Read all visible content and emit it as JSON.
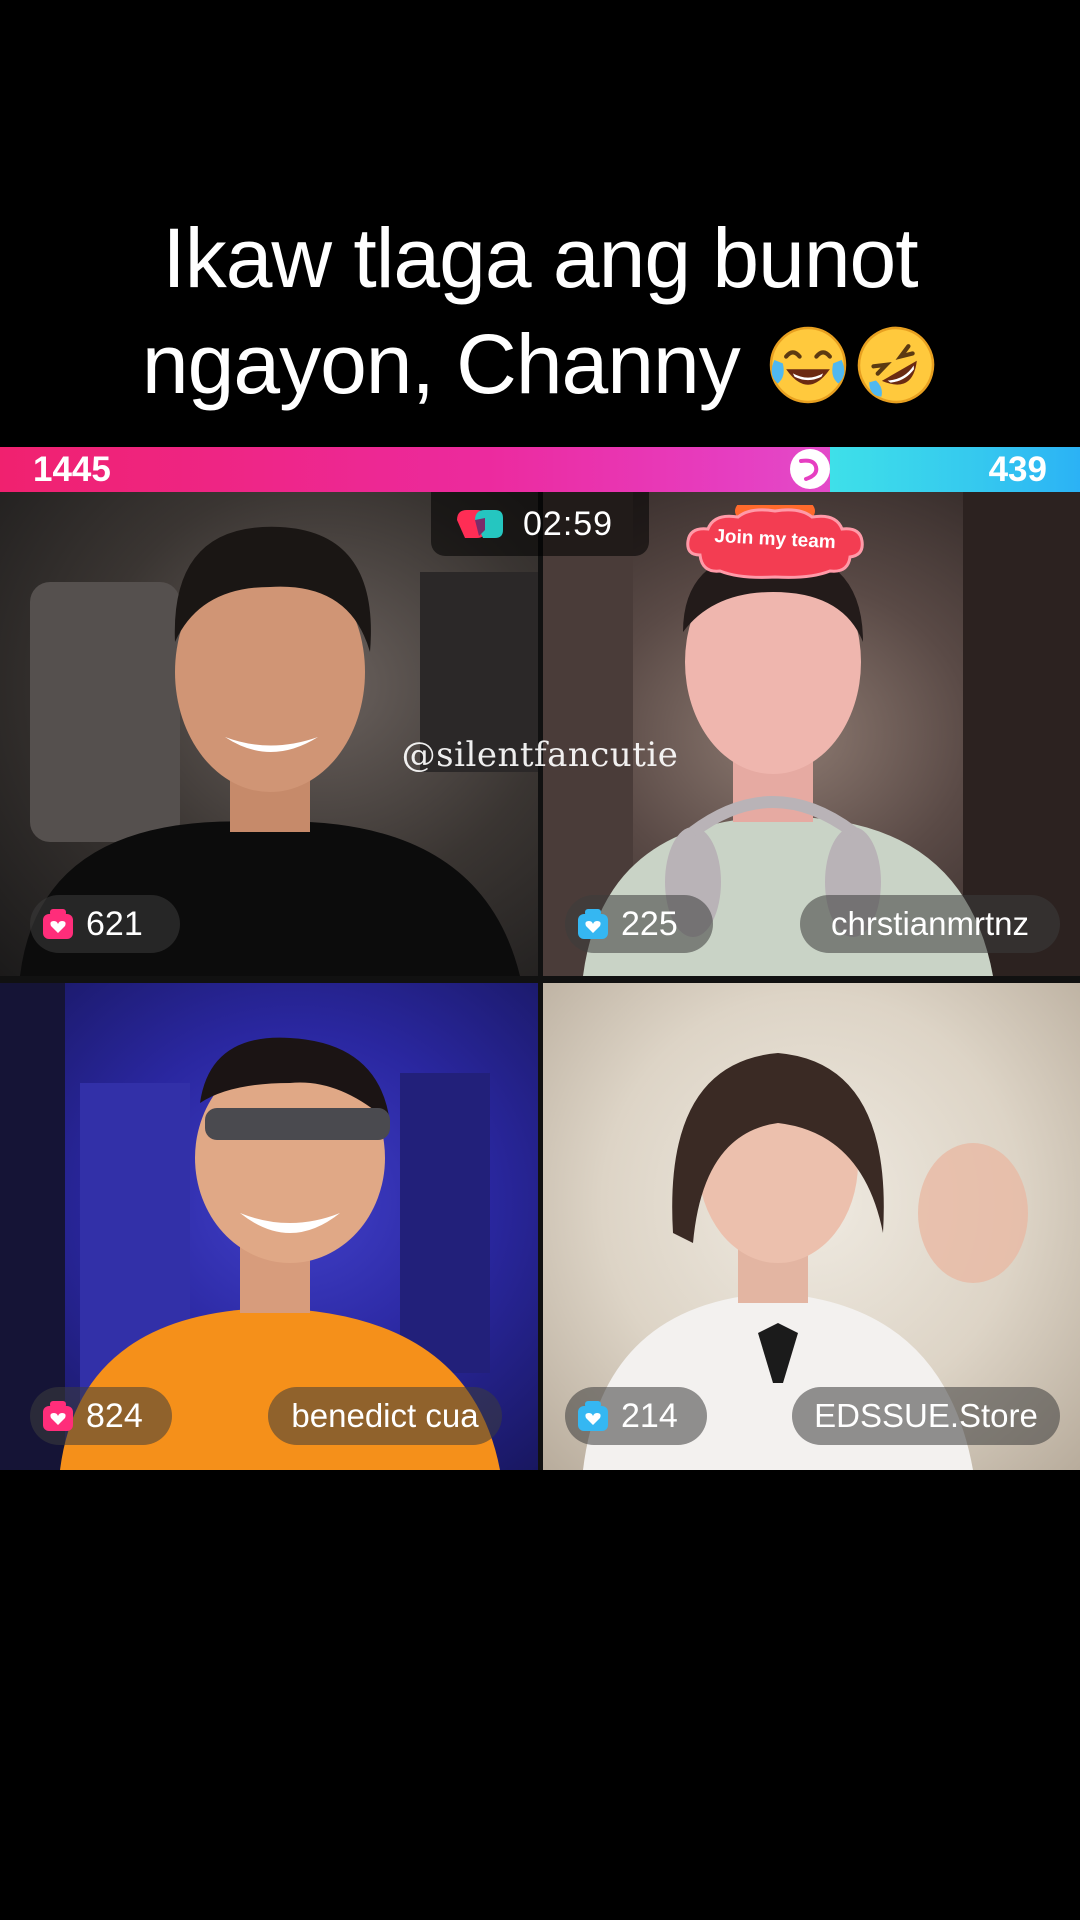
{
  "caption": {
    "line1": "Ikaw tlaga ang bunot",
    "line2": "ngayon, Channy",
    "emojis": [
      "face-with-tears-of-joy-emoji",
      "rolling-on-floor-laughing-emoji"
    ]
  },
  "battle": {
    "left_score": "1445",
    "right_score": "439",
    "timer": "02:59",
    "left_color": "#f0216f",
    "right_color": "#3ee0e9"
  },
  "overlay": {
    "join_label": "Join my team",
    "watermark": "@silentfancutie"
  },
  "participants": [
    {
      "points": "621",
      "name": "",
      "team": "pink",
      "icon": "pink-gift-icon"
    },
    {
      "points": "225",
      "name": "chrstianmrtnz",
      "team": "blue",
      "icon": "blue-gift-icon"
    },
    {
      "points": "824",
      "name": "benedict cua",
      "team": "pink",
      "icon": "pink-gift-icon"
    },
    {
      "points": "214",
      "name": "EDSSUE.Store",
      "team": "blue",
      "icon": "blue-gift-icon"
    }
  ],
  "colors": {
    "pink_team": "#ff2d7a",
    "blue_team": "#35b7f2"
  }
}
